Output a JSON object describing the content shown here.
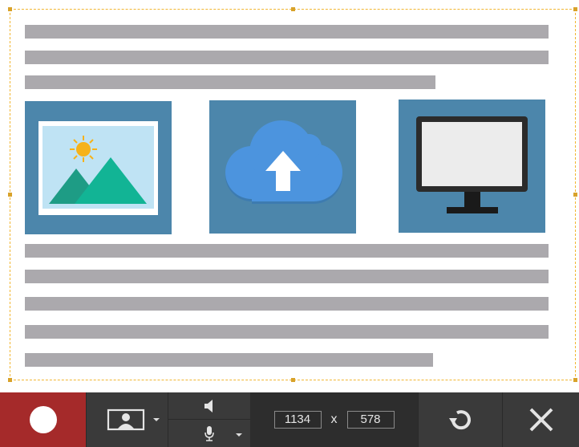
{
  "capture_area": {
    "frame_color": "#f2b632",
    "text_line_color": "#aba9ad",
    "tile_color": "#4c86ab",
    "tiles": [
      {
        "name": "image-placeholder",
        "icon": "landscape-picture-icon"
      },
      {
        "name": "cloud-upload",
        "icon": "cloud-upload-icon"
      },
      {
        "name": "monitor",
        "icon": "monitor-icon"
      }
    ]
  },
  "toolbar": {
    "record_color": "#a52a2a",
    "record_icon": "record-icon",
    "webcam_icon": "webcam-person-icon",
    "speaker_icon": "speaker-icon",
    "mic_icon": "microphone-icon",
    "width_value": "1134",
    "separator": "x",
    "height_value": "578",
    "restart_icon": "restart-icon",
    "close_icon": "close-icon"
  }
}
